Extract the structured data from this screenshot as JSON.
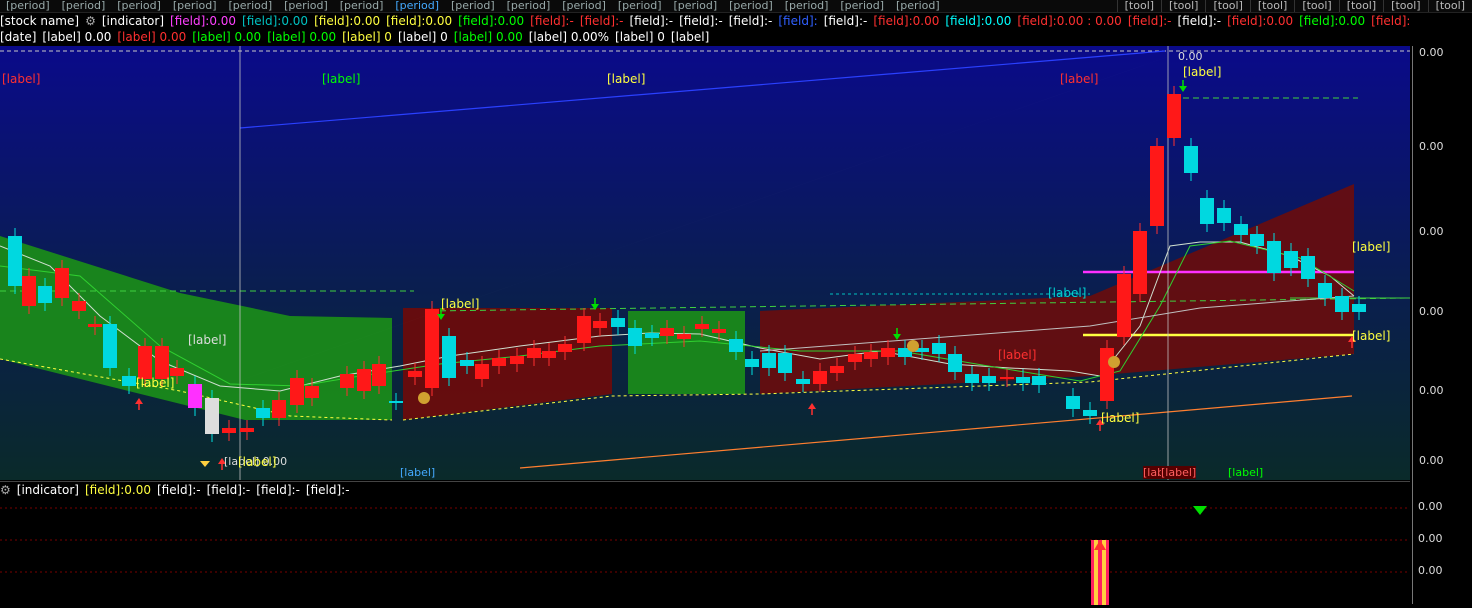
{
  "topbar": {
    "tabs": [
      "[period]",
      "[period]",
      "[period]",
      "[period]",
      "[period]",
      "[period]",
      "[period]",
      "[period]",
      "[period]",
      "[period]",
      "[period]",
      "[period]",
      "[period]",
      "[period]",
      "[period]",
      "[period]",
      "[period]"
    ],
    "active_index": 7,
    "tools": [
      "[tool]",
      "[tool]",
      "[tool]",
      "[tool]",
      "[tool]",
      "[tool]",
      "[tool]",
      "[tool]"
    ]
  },
  "header": {
    "stock_title": "[stock name]",
    "indicator_name": "[indicator]",
    "fields": [
      {
        "label": "[field]",
        "value": "0.00",
        "color": "#ff40ff"
      },
      {
        "label": "[field]",
        "value": "0.00",
        "color": "#00c0c0"
      },
      {
        "label": "[field]",
        "value": "0.00",
        "color": "#ffff40"
      },
      {
        "label": "[field]",
        "value": "0.00",
        "color": "#ffff40"
      },
      {
        "label": "[field]",
        "value": "0.00",
        "color": "#00ff00"
      },
      {
        "label": "[field]",
        "value": "-",
        "color": "#ff3030"
      },
      {
        "label": "[field]",
        "value": "-",
        "color": "#ff3030"
      },
      {
        "label": "[field]",
        "value": "-",
        "color": "#ffffff"
      },
      {
        "label": "[field]",
        "value": "-",
        "color": "#ffffff"
      },
      {
        "label": "[field]",
        "value": "-",
        "color": "#ffffff"
      },
      {
        "label": "[field]",
        "value": "",
        "color": "#3060ff"
      },
      {
        "label": "[field]",
        "value": "-",
        "color": "#ffffff"
      },
      {
        "label": "[field]",
        "value": "0.00",
        "color": "#ff3030"
      },
      {
        "label": "[field]",
        "value": "0.00",
        "color": "#00ffff"
      },
      {
        "label": "[field]",
        "value": "0.00 : 0.00",
        "color": "#ff3030"
      },
      {
        "label": "[field]",
        "value": "-",
        "color": "#ff3030"
      },
      {
        "label": "[field]",
        "value": "-",
        "color": "#ffffff"
      },
      {
        "label": "[field]",
        "value": "0.00",
        "color": "#ff3030"
      },
      {
        "label": "[field]",
        "value": "0.00",
        "color": "#00ff00"
      },
      {
        "label": "[field]",
        "value": "",
        "color": "#ff3030"
      }
    ],
    "quote_line": [
      {
        "text": "[date]",
        "color": "#ffffff"
      },
      {
        "text": "[label] 0.00",
        "color": "#ffffff"
      },
      {
        "text": "[label] 0.00",
        "color": "#ff3030"
      },
      {
        "text": "[label] 0.00",
        "color": "#00ff00"
      },
      {
        "text": "[label] 0.00",
        "color": "#00ff00"
      },
      {
        "text": "[label] 0",
        "color": "#ffff40"
      },
      {
        "text": "[label] 0",
        "color": "#ffffff"
      },
      {
        "text": "[label] 0.00",
        "color": "#00ff00"
      },
      {
        "text": "[label] 0.00%",
        "color": "#ffffff"
      },
      {
        "text": "[label] 0",
        "color": "#ffffff"
      },
      {
        "text": "[label]",
        "color": "#ffffff"
      }
    ]
  },
  "price_axis": {
    "ticks": [
      "0.00",
      "0.00",
      "0.00",
      "0.00",
      "0.00",
      "0.00"
    ]
  },
  "chart_labels": {
    "up_count": "[label]",
    "down_count": "[label]",
    "trend_score": "[label]",
    "add_position": "[label]",
    "high_marker": "0.00",
    "low_marker": "[label] 0.00",
    "bias": "[label]",
    "stop_loss_line": "[label]",
    "entry_line": "[label]",
    "tomorrow": "[label]",
    "top1": "[label]",
    "top2": "[label]",
    "bottom1": "[label]",
    "bottom2": "[label]",
    "build1": "[label]",
    "build2": "[label]",
    "cai": "[label]",
    "zhang": "[label]",
    "bang": "[label]",
    "jian": "[label]"
  },
  "sub_panel": {
    "title": "[indicator]",
    "fields": [
      {
        "label": "[field]",
        "value": "0.00",
        "color": "#ffff40"
      },
      {
        "label": "[field]",
        "value": "-",
        "color": "#ffffff"
      },
      {
        "label": "[field]",
        "value": "-",
        "color": "#ffffff"
      },
      {
        "label": "[field]",
        "value": "-",
        "color": "#ffffff"
      },
      {
        "label": "[field]",
        "value": "-",
        "color": "#ffffff"
      }
    ],
    "ticks": [
      "0.00",
      "0.00",
      "0.00"
    ]
  },
  "colors": {
    "up": "#ff2020",
    "down": "#00d0d0",
    "accent": "#ffff40"
  }
}
